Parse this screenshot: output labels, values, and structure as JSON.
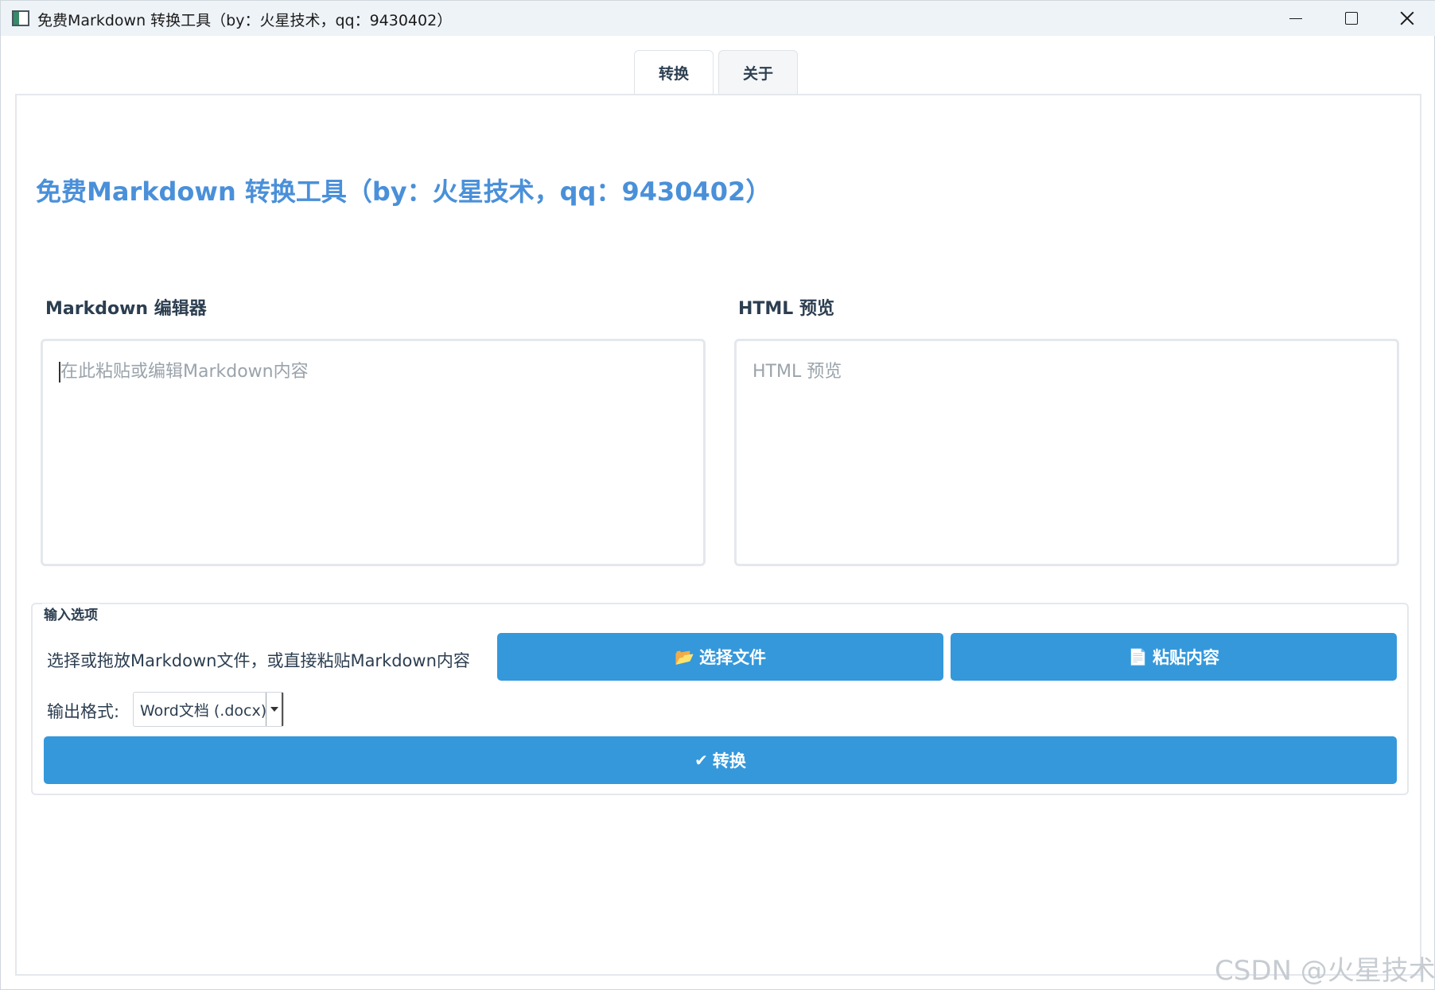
{
  "window": {
    "title": "免费Markdown 转换工具（by：火星技术，qq：9430402）"
  },
  "tabs": [
    {
      "label": "转换",
      "active": true
    },
    {
      "label": "关于",
      "active": false
    }
  ],
  "main": {
    "heading": "免费Markdown 转换工具（by：火星技术，qq：9430402）",
    "editor": {
      "label": "Markdown 编辑器",
      "placeholder": "在此粘贴或编辑Markdown内容",
      "value": ""
    },
    "preview": {
      "label": "HTML 预览",
      "placeholder": "HTML 预览"
    },
    "input_options": {
      "title": "输入选项",
      "hint": "选择或拖放Markdown文件，或直接粘贴Markdown内容",
      "choose_file_label": "选择文件",
      "choose_file_icon": "📂",
      "paste_label": "粘贴内容",
      "paste_icon": "📄",
      "format_label": "输出格式:",
      "format_selected": "Word文档 (.docx)",
      "convert_label": "转换",
      "convert_icon": "✔"
    }
  },
  "watermark": "CSDN @火星技术",
  "colors": {
    "accent": "#3498db",
    "heading": "#4a90d9",
    "text": "#2c3e50"
  }
}
